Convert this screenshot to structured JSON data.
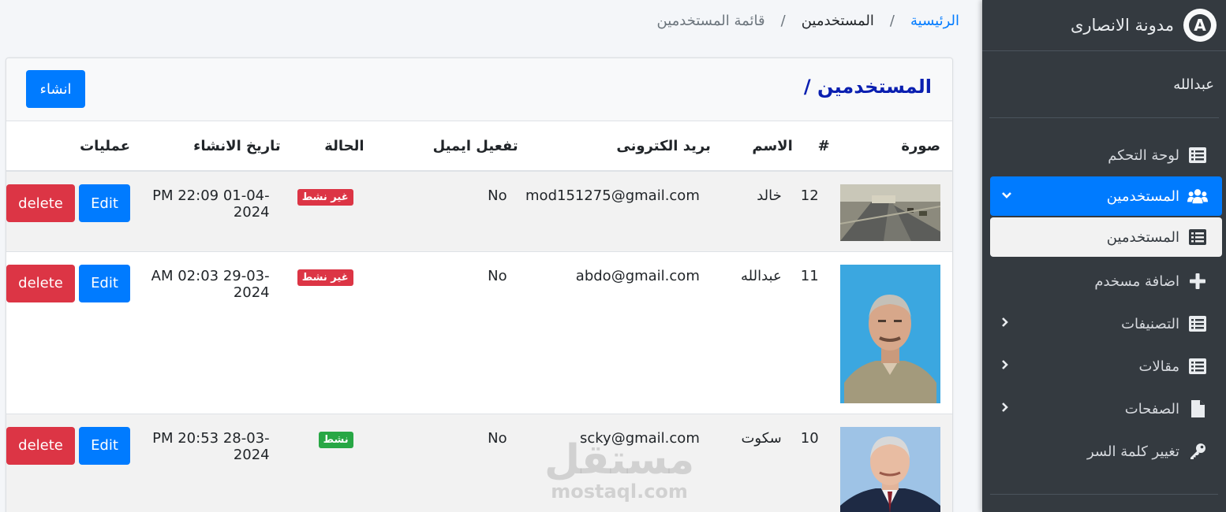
{
  "breadcrumb": {
    "home": "الرئيسية",
    "users": "المستخدمين",
    "current": "قائمة المستخدمين",
    "separator": "/"
  },
  "card": {
    "title": "المستخدمين /",
    "create_label": "انشاء"
  },
  "table": {
    "headers": {
      "image": "صورة",
      "id": "#",
      "name": "الاسم",
      "email": "بريد الكترونى",
      "activation": "تفعيل ايميل",
      "status": "الحالة",
      "created": "تاريخ الانشاء",
      "ops": "عمليات"
    },
    "rows": [
      {
        "id": "12",
        "name": "خالد",
        "email": "mod151275@gmail.com",
        "activation": "No",
        "status": "غير نشط",
        "status_active": false,
        "created": "PM 22:09 01-04-2024",
        "edit": "Edit",
        "delete": "delete",
        "image": "road-construction-photo"
      },
      {
        "id": "11",
        "name": "عبدالله",
        "email": "abdo@gmail.com",
        "activation": "No",
        "status": "غير نشط",
        "status_active": false,
        "created": "AM 02:03 29-03-2024",
        "edit": "Edit",
        "delete": "delete",
        "image": "man-portrait-blue-background"
      },
      {
        "id": "10",
        "name": "سكوت",
        "email": "scky@gmail.com",
        "activation": "No",
        "status": "نشط",
        "status_active": true,
        "created": "PM 20:53 28-03-2024",
        "edit": "Edit",
        "delete": "delete",
        "image": "man-portrait-suit"
      }
    ]
  },
  "sidebar": {
    "brand": "مدونة الانصارى",
    "brand_logo_letter": "A",
    "user": "عبدالله",
    "items": [
      {
        "label": "لوحة التحكم",
        "icon": "list-icon"
      },
      {
        "label": "المستخدمين",
        "icon": "users-icon",
        "active": true
      },
      {
        "label": "المستخدمين",
        "icon": "list-icon",
        "sub_active": true
      },
      {
        "label": "اضافة مسخدم",
        "icon": "plus-icon"
      },
      {
        "label": "التصنيفات",
        "icon": "list-icon"
      },
      {
        "label": "مقالات",
        "icon": "list-icon"
      },
      {
        "label": "الصفحات",
        "icon": "file-icon"
      },
      {
        "label": "تغيير كلمة السر",
        "icon": "key-icon"
      }
    ]
  },
  "watermark": {
    "ar": "مستقل",
    "en": "mostaql.com"
  },
  "colors": {
    "primary": "#007bff",
    "danger": "#dc3545",
    "success": "#28a745",
    "sidebar": "#343a40"
  }
}
